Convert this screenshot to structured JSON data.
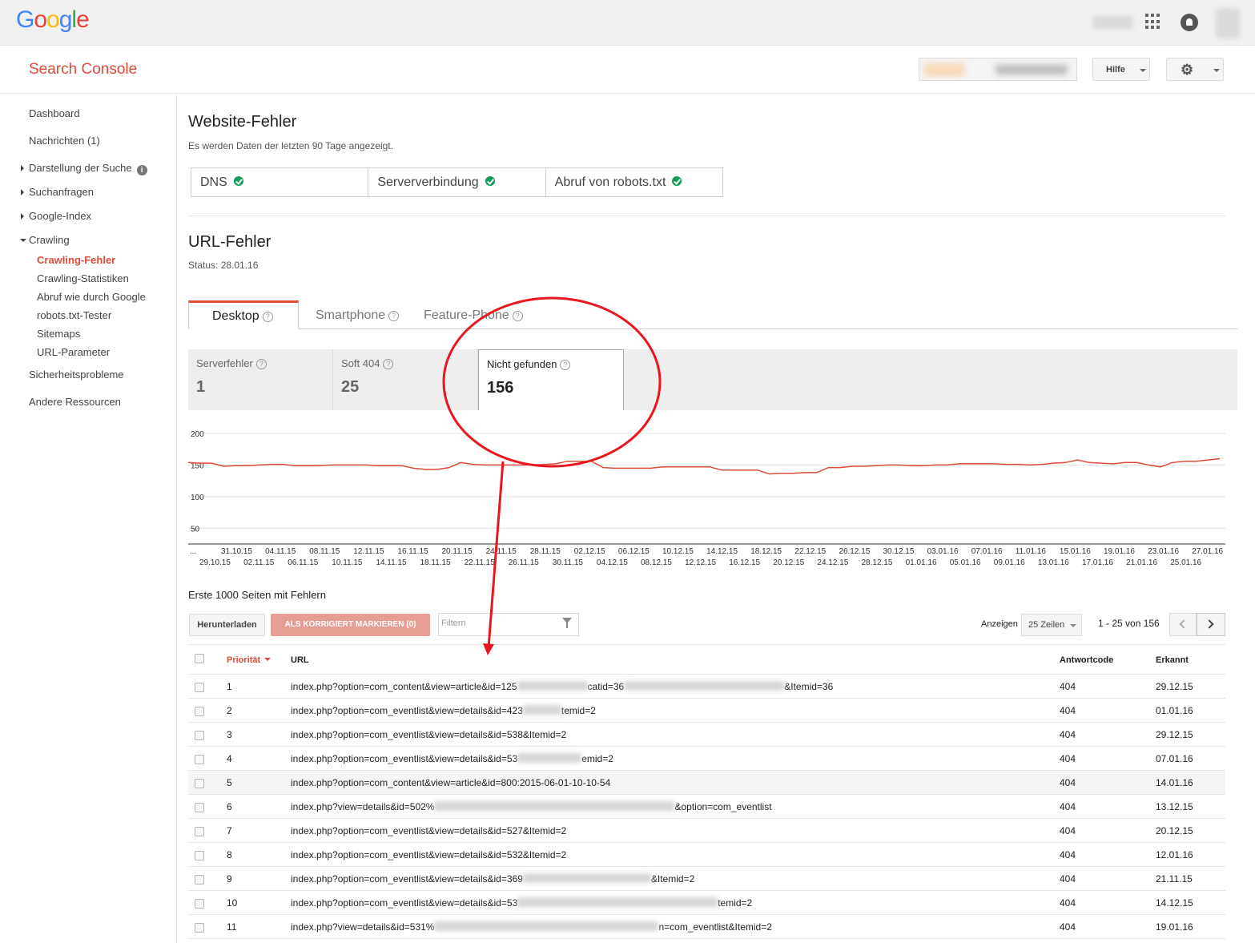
{
  "logo": {
    "text": "Google",
    "colors": [
      "#4285f4",
      "#ea4335",
      "#fbbc05",
      "#4285f4",
      "#34a853",
      "#ea4335"
    ]
  },
  "header": {
    "app_title": "Search Console",
    "help_label": "Hilfe"
  },
  "sidebar": {
    "items": [
      {
        "label": "Dashboard"
      },
      {
        "label": "Nachrichten (1)"
      },
      {
        "label": "Darstellung der Suche"
      },
      {
        "label": "Suchanfragen"
      },
      {
        "label": "Google-Index"
      },
      {
        "label": "Crawling"
      },
      {
        "label": "Crawling-Fehler"
      },
      {
        "label": "Crawling-Statistiken"
      },
      {
        "label": "Abruf wie durch Google"
      },
      {
        "label": "robots.txt-Tester"
      },
      {
        "label": "Sitemaps"
      },
      {
        "label": "URL-Parameter"
      },
      {
        "label": "Sicherheitsprobleme"
      },
      {
        "label": "Andere Ressourcen"
      }
    ]
  },
  "site_errors": {
    "title": "Website-Fehler",
    "subtitle": "Es werden Daten der letzten 90 Tage angezeigt.",
    "checks": [
      {
        "label": "DNS"
      },
      {
        "label": "Serververbindung"
      },
      {
        "label": "Abruf von robots.txt"
      }
    ]
  },
  "url_errors": {
    "title": "URL-Fehler",
    "status": "Status: 28.01.16",
    "tabs": [
      {
        "label": "Desktop"
      },
      {
        "label": "Smartphone"
      },
      {
        "label": "Feature-Phone"
      }
    ],
    "categories": [
      {
        "label": "Serverfehler",
        "count": "1"
      },
      {
        "label": "Soft 404",
        "count": "25"
      },
      {
        "label": "Nicht gefunden",
        "count": "156"
      }
    ]
  },
  "chart_data": {
    "type": "line",
    "series_color": "#dd4b39",
    "ylim": [
      25,
      200
    ],
    "yticks": [
      "200",
      "150",
      "100",
      "50"
    ],
    "x_labels_top": [
      "31.10.15",
      "04.11.15",
      "08.11.15",
      "12.11.15",
      "16.11.15",
      "20.11.15",
      "24.11.15",
      "28.11.15",
      "02.12.15",
      "06.12.15",
      "10.12.15",
      "14.12.15",
      "18.12.15",
      "22.12.15",
      "26.12.15",
      "30.12.15",
      "03.01.16",
      "07.01.16",
      "11.01.16",
      "15.01.16",
      "19.01.16",
      "23.01.16",
      "27.01.16"
    ],
    "x_labels_bottom": [
      "29.10.15",
      "02.11.15",
      "06.11.15",
      "10.11.15",
      "14.11.15",
      "18.11.15",
      "22.11.15",
      "26.11.15",
      "30.11.15",
      "04.12.15",
      "08.12.15",
      "12.12.15",
      "16.12.15",
      "20.12.15",
      "24.12.15",
      "28.12.15",
      "01.01.16",
      "05.01.16",
      "09.01.16",
      "13.01.16",
      "17.01.16",
      "21.01.16",
      "25.01.16"
    ],
    "leading_label": "...",
    "values": [
      154,
      153,
      153,
      148,
      149,
      149,
      150,
      151,
      151,
      149,
      149,
      149,
      150,
      150,
      150,
      150,
      149,
      149,
      149,
      145,
      143,
      143,
      146,
      154,
      151,
      150,
      150,
      150,
      150,
      150,
      151,
      152,
      156,
      156,
      156,
      146,
      145,
      145,
      145,
      145,
      147,
      147,
      147,
      147,
      147,
      142,
      142,
      142,
      142,
      136,
      137,
      137,
      138,
      138,
      146,
      146,
      148,
      148,
      149,
      150,
      150,
      149,
      149,
      150,
      150,
      152,
      152,
      152,
      152,
      151,
      151,
      150,
      151,
      153,
      154,
      158,
      154,
      153,
      152,
      154,
      154,
      150,
      147,
      154,
      156,
      156,
      158,
      160
    ]
  },
  "table": {
    "caption": "Erste 1000 Seiten mit Fehlern",
    "download_label": "Herunterladen",
    "mark_fixed_label": "ALS KORRIGIERT MARKIEREN (0)",
    "filter_placeholder": "Filtern",
    "show_label": "Anzeigen",
    "rows_option": "25 Zeilen",
    "range": "1 - 25 von 156",
    "columns": {
      "priority": "Priorität",
      "url": "URL",
      "code": "Antwortcode",
      "detected": "Erkannt"
    },
    "rows": [
      {
        "priority": "1",
        "url_a": "index.php?option=com_content&view=article&id=125",
        "url_b": "catid=36",
        "url_c": "&Itemid=36",
        "code": "404",
        "date": "29.12.15"
      },
      {
        "priority": "2",
        "url_a": "index.php?option=com_eventlist&view=details&id=423",
        "url_b": "temid=2",
        "url_c": "",
        "code": "404",
        "date": "01.01.16"
      },
      {
        "priority": "3",
        "url_a": "index.php?option=com_eventlist&view=details&id=538&Itemid=2",
        "url_b": "",
        "url_c": "",
        "code": "404",
        "date": "29.12.15"
      },
      {
        "priority": "4",
        "url_a": "index.php?option=com_eventlist&view=details&id=53",
        "url_b": "emid=2",
        "url_c": "",
        "code": "404",
        "date": "07.01.16"
      },
      {
        "priority": "5",
        "url_a": "index.php?option=com_content&view=article&id=800:2015-06-01-10-10-54",
        "url_b": "",
        "url_c": "",
        "code": "404",
        "date": "14.01.16"
      },
      {
        "priority": "6",
        "url_a": "index.php?view=details&id=502%",
        "url_b": "&option=com_eventlist",
        "url_c": "",
        "code": "404",
        "date": "13.12.15"
      },
      {
        "priority": "7",
        "url_a": "index.php?option=com_eventlist&view=details&id=527&Itemid=2",
        "url_b": "",
        "url_c": "",
        "code": "404",
        "date": "20.12.15"
      },
      {
        "priority": "8",
        "url_a": "index.php?option=com_eventlist&view=details&id=532&Itemid=2",
        "url_b": "",
        "url_c": "",
        "code": "404",
        "date": "12.01.16"
      },
      {
        "priority": "9",
        "url_a": "index.php?option=com_eventlist&view=details&id=369",
        "url_b": "&Itemid=2",
        "url_c": "",
        "code": "404",
        "date": "21.11.15"
      },
      {
        "priority": "10",
        "url_a": "index.php?option=com_eventlist&view=details&id=53",
        "url_b": "temid=2",
        "url_c": "",
        "code": "404",
        "date": "14.12.15"
      },
      {
        "priority": "11",
        "url_a": "index.php?view=details&id=531%",
        "url_b": "n=com_eventlist&Itemid=2",
        "url_c": "",
        "code": "404",
        "date": "19.01.16"
      }
    ]
  }
}
